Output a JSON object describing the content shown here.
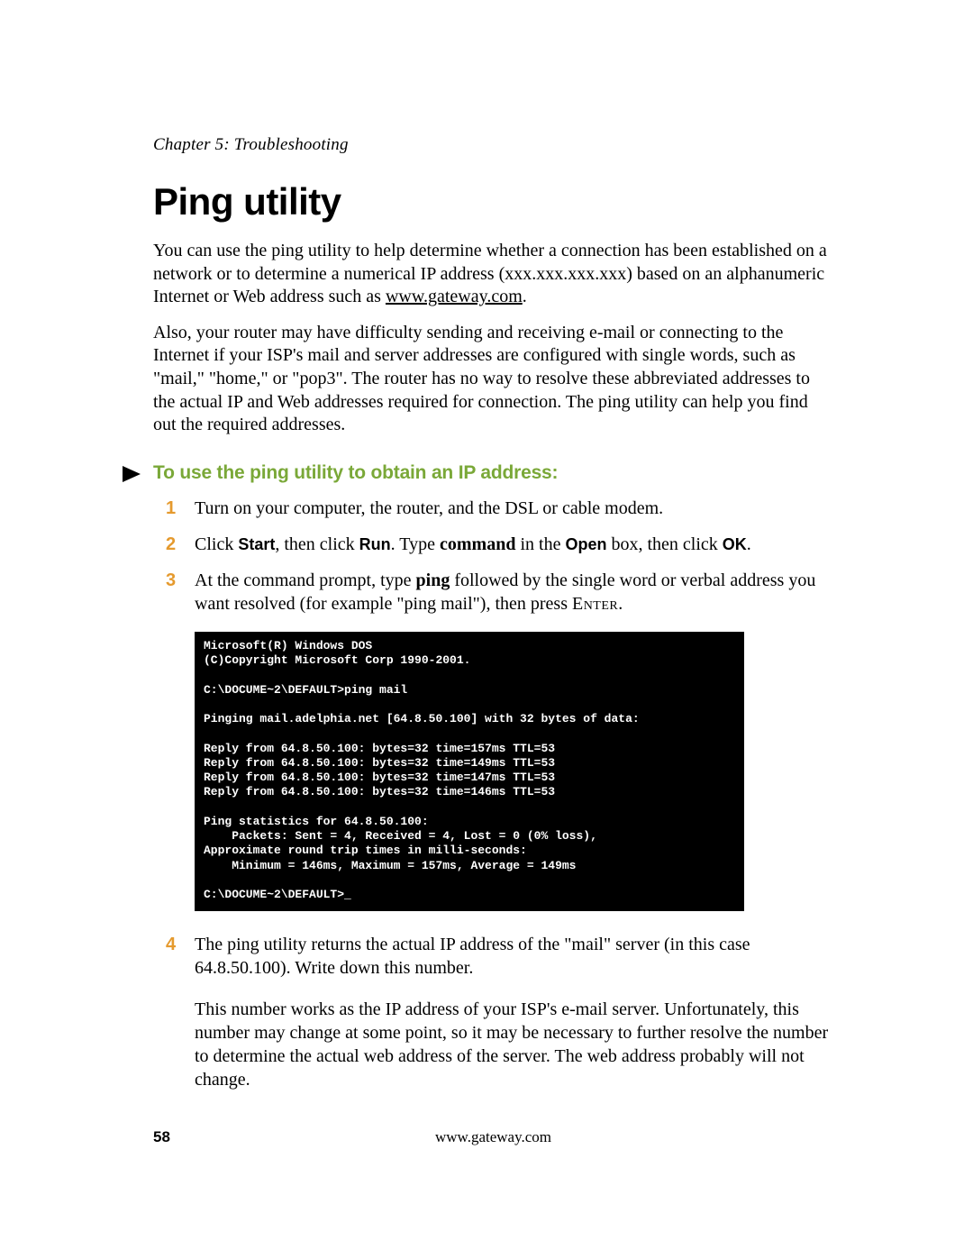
{
  "header": {
    "chapter": "Chapter 5: Troubleshooting"
  },
  "title": "Ping utility",
  "intro": {
    "p1_prefix": "You can use the ping utility to help determine whether a connection has been established on a network or to determine a numerical IP address (xxx.xxx.xxx.xxx) based on an alphanumeric Internet or Web address such as ",
    "p1_link": "www.gateway.com",
    "p1_suffix": ".",
    "p2": "Also, your router may have difficulty sending and receiving e-mail or connecting to the Internet if your ISP's mail and server addresses are configured with single words, such as \"mail,\" \"home,\" or \"pop3\". The router has no way to resolve these abbreviated addresses to the actual IP and Web addresses required for connection. The ping utility can help you find out the required addresses."
  },
  "subhead": "To use the ping utility to obtain an IP address:",
  "steps": {
    "s1_num": "1",
    "s1_text": "Turn on your computer, the router, and the DSL or cable modem.",
    "s2_num": "2",
    "s2_a": "Click ",
    "s2_start": "Start",
    "s2_b": ", then click ",
    "s2_run": "Run",
    "s2_c": ". Type ",
    "s2_command": "command",
    "s2_d": " in the ",
    "s2_open": "Open",
    "s2_e": " box, then click ",
    "s2_ok": "OK",
    "s2_f": ".",
    "s3_num": "3",
    "s3_a": "At the command prompt, type ",
    "s3_ping": "ping",
    "s3_b": " followed by the single word or verbal address you want resolved (for example \"ping mail\"), then press ",
    "s3_enter": "Enter",
    "s3_c": ".",
    "s4_num": "4",
    "s4_text": "The ping utility returns the actual IP address of the \"mail\" server (in this case 64.8.50.100). Write down this number.",
    "s4_follow": "This number works as the IP address of your ISP's e-mail server. Unfortunately, this number may change at some point, so it may be necessary to further resolve the number to determine the actual web address of the server. The web address probably will not change."
  },
  "terminal": {
    "l1": "Microsoft(R) Windows DOS",
    "l2": "(C)Copyright Microsoft Corp 1990-2001.",
    "l3": "",
    "l4": "C:\\DOCUME~2\\DEFAULT>ping mail",
    "l5": "",
    "l6": "Pinging mail.adelphia.net [64.8.50.100] with 32 bytes of data:",
    "l7": "",
    "l8": "Reply from 64.8.50.100: bytes=32 time=157ms TTL=53",
    "l9": "Reply from 64.8.50.100: bytes=32 time=149ms TTL=53",
    "l10": "Reply from 64.8.50.100: bytes=32 time=147ms TTL=53",
    "l11": "Reply from 64.8.50.100: bytes=32 time=146ms TTL=53",
    "l12": "",
    "l13": "Ping statistics for 64.8.50.100:",
    "l14": "    Packets: Sent = 4, Received = 4, Lost = 0 (0% loss),",
    "l15": "Approximate round trip times in milli-seconds:",
    "l16": "    Minimum = 146ms, Maximum = 157ms, Average = 149ms",
    "l17": "",
    "l18": "C:\\DOCUME~2\\DEFAULT>_"
  },
  "footer": {
    "page": "58",
    "url": "www.gateway.com"
  }
}
